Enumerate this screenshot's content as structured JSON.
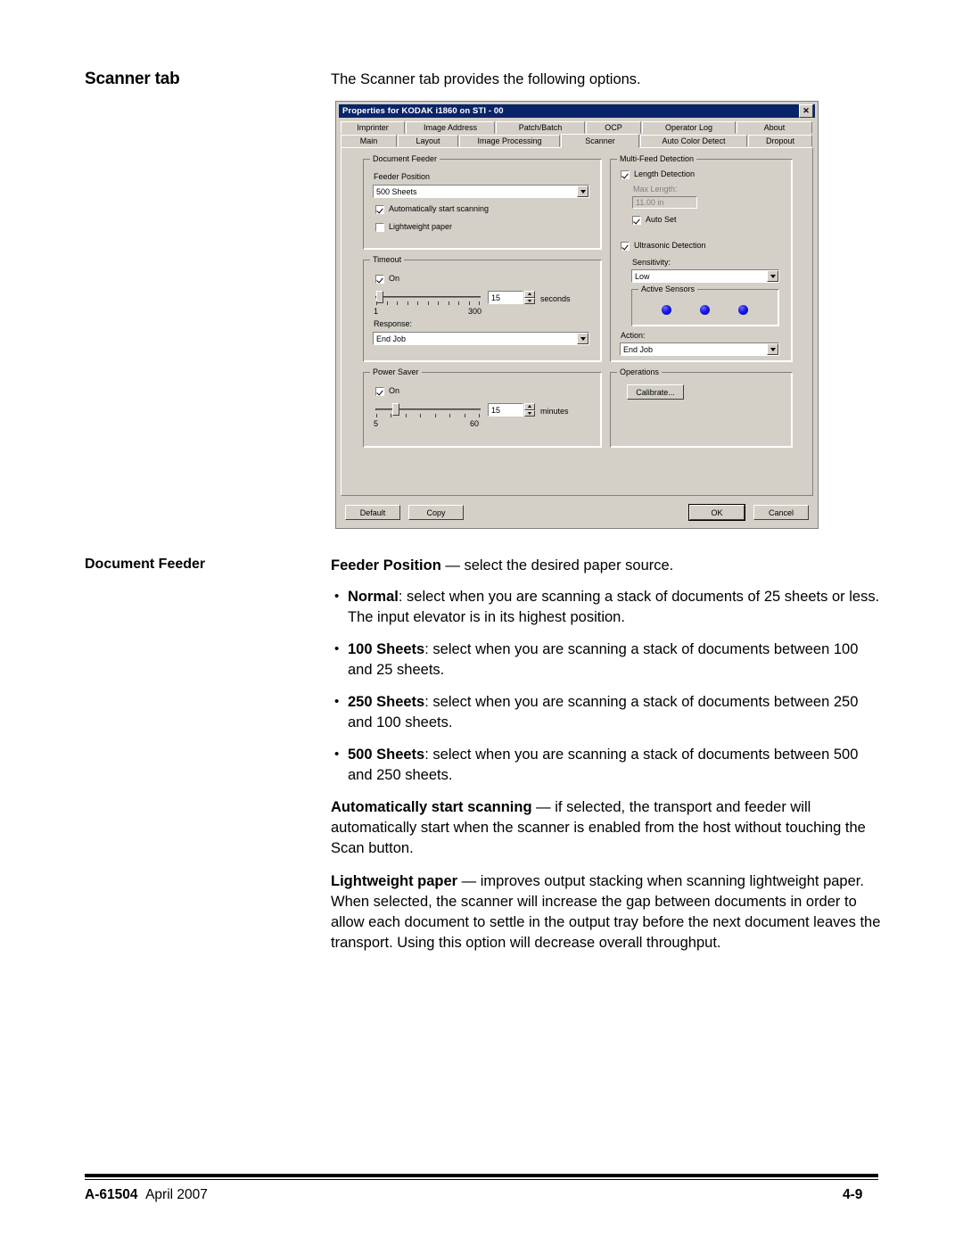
{
  "document": {
    "section_title": "Scanner tab",
    "intro": "The Scanner tab provides the following options.",
    "label_column": "Document Feeder",
    "feeder_position_head": "Feeder Position",
    "feeder_position_rest": " — select the desired paper source.",
    "bullets": [
      {
        "term": "Normal",
        "rest": ": select when you are scanning a stack of documents of 25 sheets or less. The input elevator is in its highest position."
      },
      {
        "term": "100 Sheets",
        "rest": ": select when you are scanning a stack of documents between 100 and 25 sheets."
      },
      {
        "term": "250 Sheets",
        "rest": ": select when you are scanning a stack of documents between 250 and 100 sheets."
      },
      {
        "term": "500 Sheets",
        "rest": ": select when you are scanning a stack of documents between 500 and 250 sheets."
      }
    ],
    "auto_start_head": "Automatically start scanning",
    "auto_start_rest": " — if selected, the transport and feeder will automatically start when the scanner is enabled from the host without touching the Scan button.",
    "lightweight_head": "Lightweight paper",
    "lightweight_rest": " — improves output stacking when scanning lightweight paper. When selected, the scanner will increase the gap between documents in order to allow each document to settle in the output tray before the next document leaves the transport. Using this option will decrease overall throughput."
  },
  "footer": {
    "doc_code": "A-61504",
    "date": "April 2007",
    "page_number": "4-9"
  },
  "dialog": {
    "title": "Properties for KODAK i1860 on STI - 00",
    "close_label": "✕",
    "tabs_row1": [
      "Imprinter",
      "Image Address",
      "Patch/Batch",
      "OCP",
      "Operator Log",
      "About"
    ],
    "tabs_row2": [
      "Main",
      "Layout",
      "Image Processing",
      "Scanner",
      "Auto Color Detect",
      "Dropout"
    ],
    "active_tab": "Scanner",
    "document_feeder": {
      "group_title": "Document Feeder",
      "feeder_position_label": "Feeder Position",
      "feeder_position_value": "500 Sheets",
      "auto_start_label": "Automatically start scanning",
      "auto_start_checked": true,
      "lightweight_label": "Lightweight paper",
      "lightweight_checked": false
    },
    "timeout": {
      "group_title": "Timeout",
      "on_label": "On",
      "on_checked": true,
      "slider_min": "1",
      "slider_max": "300",
      "value": "15",
      "units": "seconds",
      "response_label": "Response:",
      "response_value": "End Job"
    },
    "power_saver": {
      "group_title": "Power Saver",
      "on_label": "On",
      "on_checked": true,
      "slider_min": "5",
      "slider_max": "60",
      "value": "15",
      "units": "minutes"
    },
    "multifeed": {
      "group_title": "Multi-Feed Detection",
      "length_detection_label": "Length Detection",
      "length_detection_checked": true,
      "max_length_label": "Max Length:",
      "max_length_value": "11.00 in",
      "max_length_disabled": true,
      "auto_set_label": "Auto Set",
      "auto_set_checked": true,
      "ultrasonic_label": "Ultrasonic Detection",
      "ultrasonic_checked": true,
      "sensitivity_label": "Sensitivity:",
      "sensitivity_value": "Low",
      "active_sensors_label": "Active Sensors",
      "sensor_count": 3,
      "sensor_color": "#1818e8",
      "action_label": "Action:",
      "action_value": "End Job"
    },
    "operations": {
      "group_title": "Operations",
      "calibrate_label": "Calibrate..."
    },
    "buttons": {
      "default": "Default",
      "copy": "Copy",
      "ok": "OK",
      "cancel": "Cancel"
    }
  }
}
